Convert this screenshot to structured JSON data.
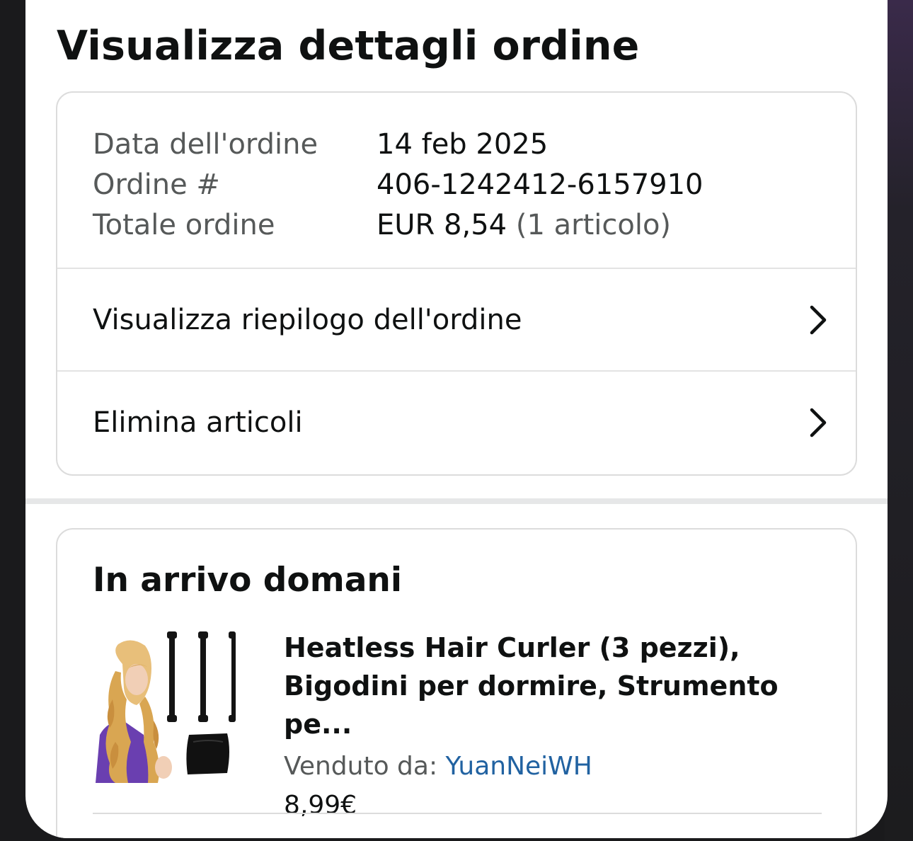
{
  "page": {
    "title": "Visualizza dettagli ordine"
  },
  "order_info": {
    "rows": [
      {
        "label": "Data dell'ordine",
        "value": "14 feb 2025"
      },
      {
        "label": "Ordine #",
        "value": "406-1242412-6157910"
      },
      {
        "label": "Totale ordine",
        "value": "EUR 8,54",
        "value_suffix": "(1 articolo)"
      }
    ]
  },
  "links": {
    "summary": {
      "label": "Visualizza riepilogo dell'ordine",
      "icon": "chevron-right-icon"
    },
    "delete": {
      "label": "Elimina articoli",
      "icon": "chevron-right-icon"
    }
  },
  "shipment": {
    "heading": "In arrivo domani",
    "item": {
      "title_line1": "Heatless Hair Curler (3 pezzi),",
      "title_line2": "Bigodini per dormire, Strumento pe...",
      "seller_label": "Venduto da: ",
      "seller_name": "YuanNeiWH",
      "price": "8,99€"
    }
  },
  "colors": {
    "text_primary": "#0f1111",
    "text_secondary": "#565959",
    "link": "#2162a1",
    "border": "#dcdcdc"
  }
}
